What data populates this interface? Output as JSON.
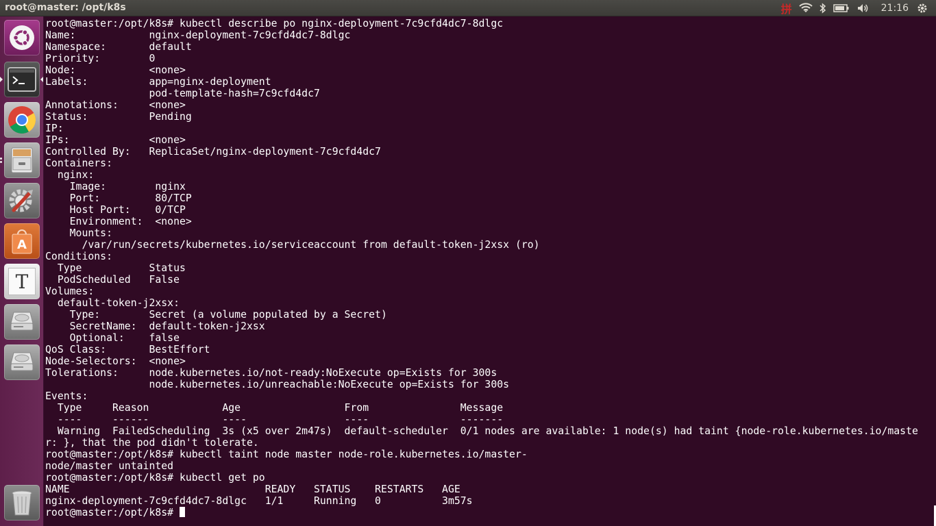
{
  "window": {
    "title": "root@master: /opt/k8s"
  },
  "panel": {
    "ime_glyph": "拼",
    "clock": "21:16",
    "indicators": [
      "ime-icon",
      "wifi-icon",
      "bluetooth-icon",
      "battery-icon",
      "volume-icon",
      "gear-icon"
    ]
  },
  "launcher": {
    "items": [
      {
        "name": "ubuntu-dash",
        "icon": "ubuntu-logo-icon",
        "active": false
      },
      {
        "name": "terminal",
        "icon": "terminal-icon",
        "active": true
      },
      {
        "name": "chrome",
        "icon": "chrome-icon",
        "active": false
      },
      {
        "name": "files",
        "icon": "file-cabinet-icon",
        "active": false
      },
      {
        "name": "system-settings",
        "icon": "settings-icon",
        "active": false
      },
      {
        "name": "software-center",
        "icon": "shopping-bag-icon",
        "active": false
      },
      {
        "name": "text-editor",
        "icon": "text-editor-icon",
        "active": false
      },
      {
        "name": "drive-1",
        "icon": "hard-drive-icon",
        "active": false
      },
      {
        "name": "drive-2",
        "icon": "hard-drive-icon",
        "active": false
      },
      {
        "name": "trash",
        "icon": "trash-icon",
        "active": false
      }
    ],
    "text_editor_glyph": "T",
    "software_center_glyph": "A"
  },
  "terminal": {
    "lines": [
      "root@master:/opt/k8s# kubectl describe po nginx-deployment-7c9cfd4dc7-8dlgc",
      "Name:            nginx-deployment-7c9cfd4dc7-8dlgc",
      "Namespace:       default",
      "Priority:        0",
      "Node:            <none>",
      "Labels:          app=nginx-deployment",
      "                 pod-template-hash=7c9cfd4dc7",
      "Annotations:     <none>",
      "Status:          Pending",
      "IP:",
      "IPs:             <none>",
      "Controlled By:   ReplicaSet/nginx-deployment-7c9cfd4dc7",
      "Containers:",
      "  nginx:",
      "    Image:        nginx",
      "    Port:         80/TCP",
      "    Host Port:    0/TCP",
      "    Environment:  <none>",
      "    Mounts:",
      "      /var/run/secrets/kubernetes.io/serviceaccount from default-token-j2xsx (ro)",
      "Conditions:",
      "  Type           Status",
      "  PodScheduled   False",
      "Volumes:",
      "  default-token-j2xsx:",
      "    Type:        Secret (a volume populated by a Secret)",
      "    SecretName:  default-token-j2xsx",
      "    Optional:    false",
      "QoS Class:       BestEffort",
      "Node-Selectors:  <none>",
      "Tolerations:     node.kubernetes.io/not-ready:NoExecute op=Exists for 300s",
      "                 node.kubernetes.io/unreachable:NoExecute op=Exists for 300s",
      "Events:",
      "  Type     Reason            Age                 From               Message",
      "  ----     ------            ----                ----               -------",
      "  Warning  FailedScheduling  3s (x5 over 2m47s)  default-scheduler  0/1 nodes are available: 1 node(s) had taint {node-role.kubernetes.io/maste",
      "r: }, that the pod didn't tolerate.",
      "root@master:/opt/k8s# kubectl taint node master node-role.kubernetes.io/master-",
      "node/master untainted",
      "root@master:/opt/k8s# kubectl get po",
      "NAME                                READY   STATUS    RESTARTS   AGE",
      "nginx-deployment-7c9cfd4dc7-8dlgc   1/1     Running   0          3m57s"
    ],
    "prompt": "root@master:/opt/k8s# "
  },
  "colors": {
    "terminal_bg": "#300a24",
    "panel_bg": "#3c3b37",
    "launcher_bg": "#5e1f4a"
  }
}
